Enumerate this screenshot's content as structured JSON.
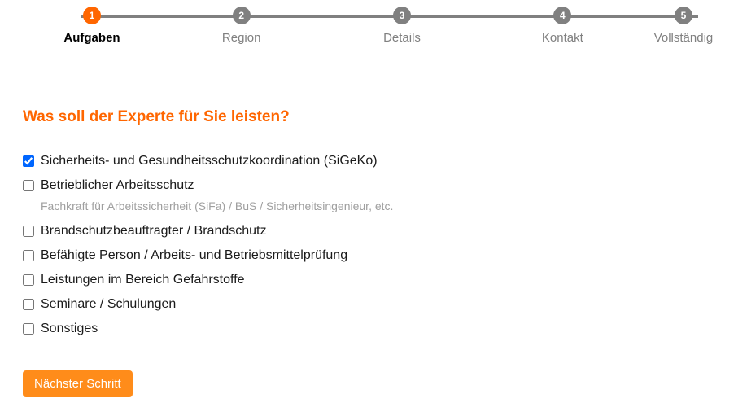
{
  "stepper": {
    "steps": [
      {
        "num": "1",
        "label": "Aufgaben",
        "active": true
      },
      {
        "num": "2",
        "label": "Region",
        "active": false
      },
      {
        "num": "3",
        "label": "Details",
        "active": false
      },
      {
        "num": "4",
        "label": "Kontakt",
        "active": false
      },
      {
        "num": "5",
        "label": "Vollständig",
        "active": false
      }
    ]
  },
  "form": {
    "heading": "Was soll der Experte für Sie leisten?",
    "options": [
      {
        "label": "Sicherheits- und Gesundheitsschutzkoordination (SiGeKo)",
        "checked": true
      },
      {
        "label": "Betrieblicher Arbeitsschutz",
        "checked": false,
        "hint": "Fachkraft für Arbeitssicherheit (SiFa) / BuS / Sicherheitsingenieur, etc."
      },
      {
        "label": "Brandschutzbeauftragter / Brandschutz",
        "checked": false
      },
      {
        "label": "Befähigte Person / Arbeits- und Betriebsmittelprüfung",
        "checked": false
      },
      {
        "label": "Leistungen im Bereich Gefahrstoffe",
        "checked": false
      },
      {
        "label": "Seminare / Schulungen",
        "checked": false
      },
      {
        "label": "Sonstiges",
        "checked": false
      }
    ],
    "next_button": "Nächster Schritt"
  }
}
